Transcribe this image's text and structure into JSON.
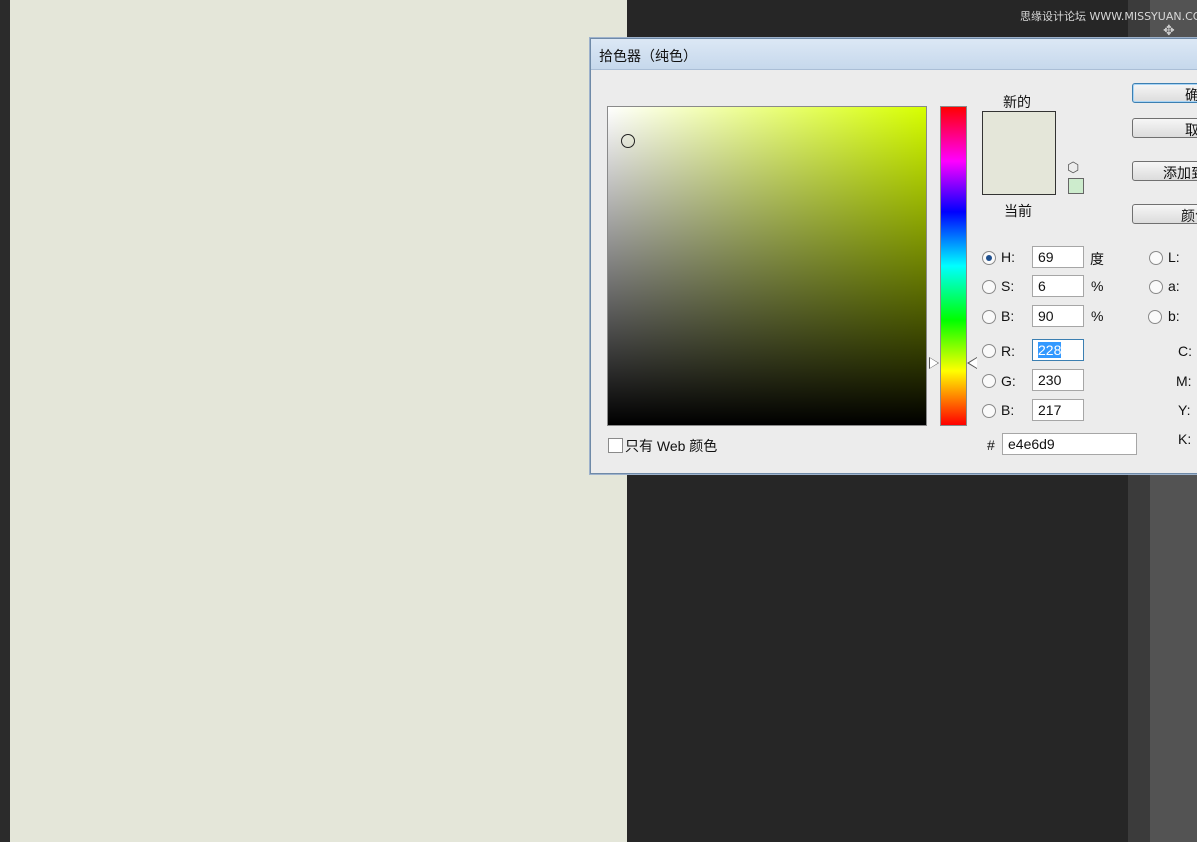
{
  "watermark": "思缘设计论坛 WWW.MISSYUAN.COM",
  "dialog": {
    "title": "拾色器（纯色）",
    "new_label": "新的",
    "current_label": "当前",
    "new_color": "#e4e6d9",
    "current_color": "#e4e6d9",
    "websafe_color": "#cdeccd",
    "web_only_label": "只有 Web 颜色",
    "fields": {
      "H": {
        "label": "H:",
        "value": "69",
        "unit": "度"
      },
      "S": {
        "label": "S:",
        "value": "6",
        "unit": "%"
      },
      "B": {
        "label": "B:",
        "value": "90",
        "unit": "%"
      },
      "R": {
        "label": "R:",
        "value": "228"
      },
      "G": {
        "label": "G:",
        "value": "230"
      },
      "Bl": {
        "label": "B:",
        "value": "217"
      },
      "L": {
        "label": "L:"
      },
      "a": {
        "label": "a:"
      },
      "b": {
        "label": "b:"
      },
      "C": {
        "label": "C:"
      },
      "M": {
        "label": "M:"
      },
      "Y": {
        "label": "Y:"
      },
      "K": {
        "label": "K:"
      }
    },
    "hex_prefix": "#",
    "hex_value": "e4e6d9",
    "buttons": {
      "ok": "确",
      "cancel": "取",
      "add": "添加到",
      "library": "颜色"
    }
  },
  "canvas_color": "#e4e6d9"
}
